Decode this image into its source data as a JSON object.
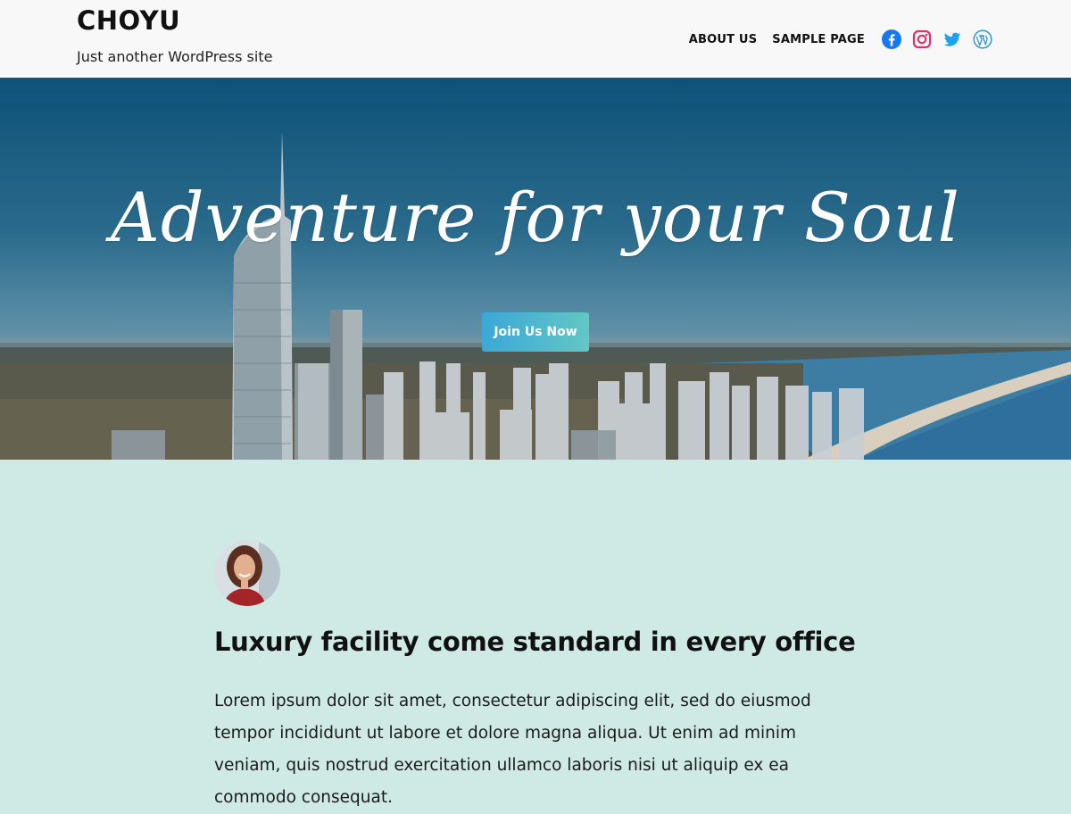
{
  "header": {
    "site_title": "CHOYU",
    "tagline": "Just another WordPress site",
    "nav": [
      {
        "label": "ABOUT US"
      },
      {
        "label": "SAMPLE PAGE"
      }
    ],
    "social": [
      {
        "icon": "facebook-icon",
        "color": "#1877f2"
      },
      {
        "icon": "instagram-icon",
        "color": "#e1306c"
      },
      {
        "icon": "twitter-icon",
        "color": "#1da1f2"
      },
      {
        "icon": "wordpress-icon",
        "color": "#3a9bd6"
      }
    ]
  },
  "hero": {
    "heading": "Adventure for your Soul",
    "button_label": "Join Us Now",
    "button_gradient": [
      "#3aa8d8",
      "#63c7c4"
    ]
  },
  "content": {
    "title": "Luxury facility come standard in every office",
    "body": "Lorem ipsum dolor sit amet, consectetur adipiscing elit, sed do eiusmod tempor incididunt ut labore et dolore magna aliqua. Ut enim ad minim veniam, quis nostrud exercitation ullamco laboris nisi ut aliquip ex ea commodo consequat.",
    "background": "#cfeae5"
  }
}
